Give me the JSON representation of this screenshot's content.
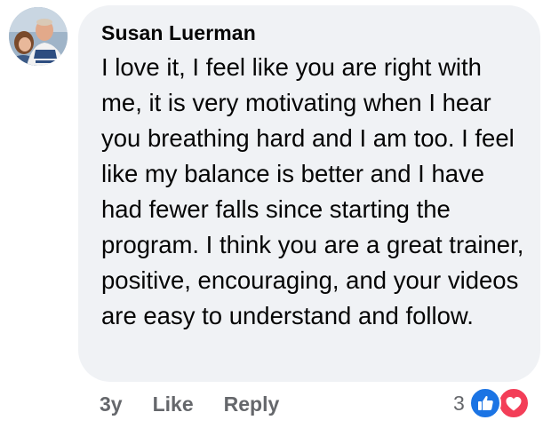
{
  "comment": {
    "author": "Susan Luerman",
    "text": "I love it, I feel like you are right with me, it is very motivating when I hear you breathing hard and I am too. I feel like my balance is better and I have had fewer falls since starting the program. I think you are a great trainer, positive, encouraging, and your videos are easy to understand and follow.",
    "age": "3y",
    "like_label": "Like",
    "reply_label": "Reply",
    "reaction_count": "3",
    "reactions": [
      "like-icon",
      "love-icon"
    ]
  },
  "colors": {
    "bubble_bg": "#f0f2f5",
    "text": "#050505",
    "secondary_text": "#65676b",
    "like_blue": "#1b74e4",
    "love_red": "#f33e58"
  }
}
